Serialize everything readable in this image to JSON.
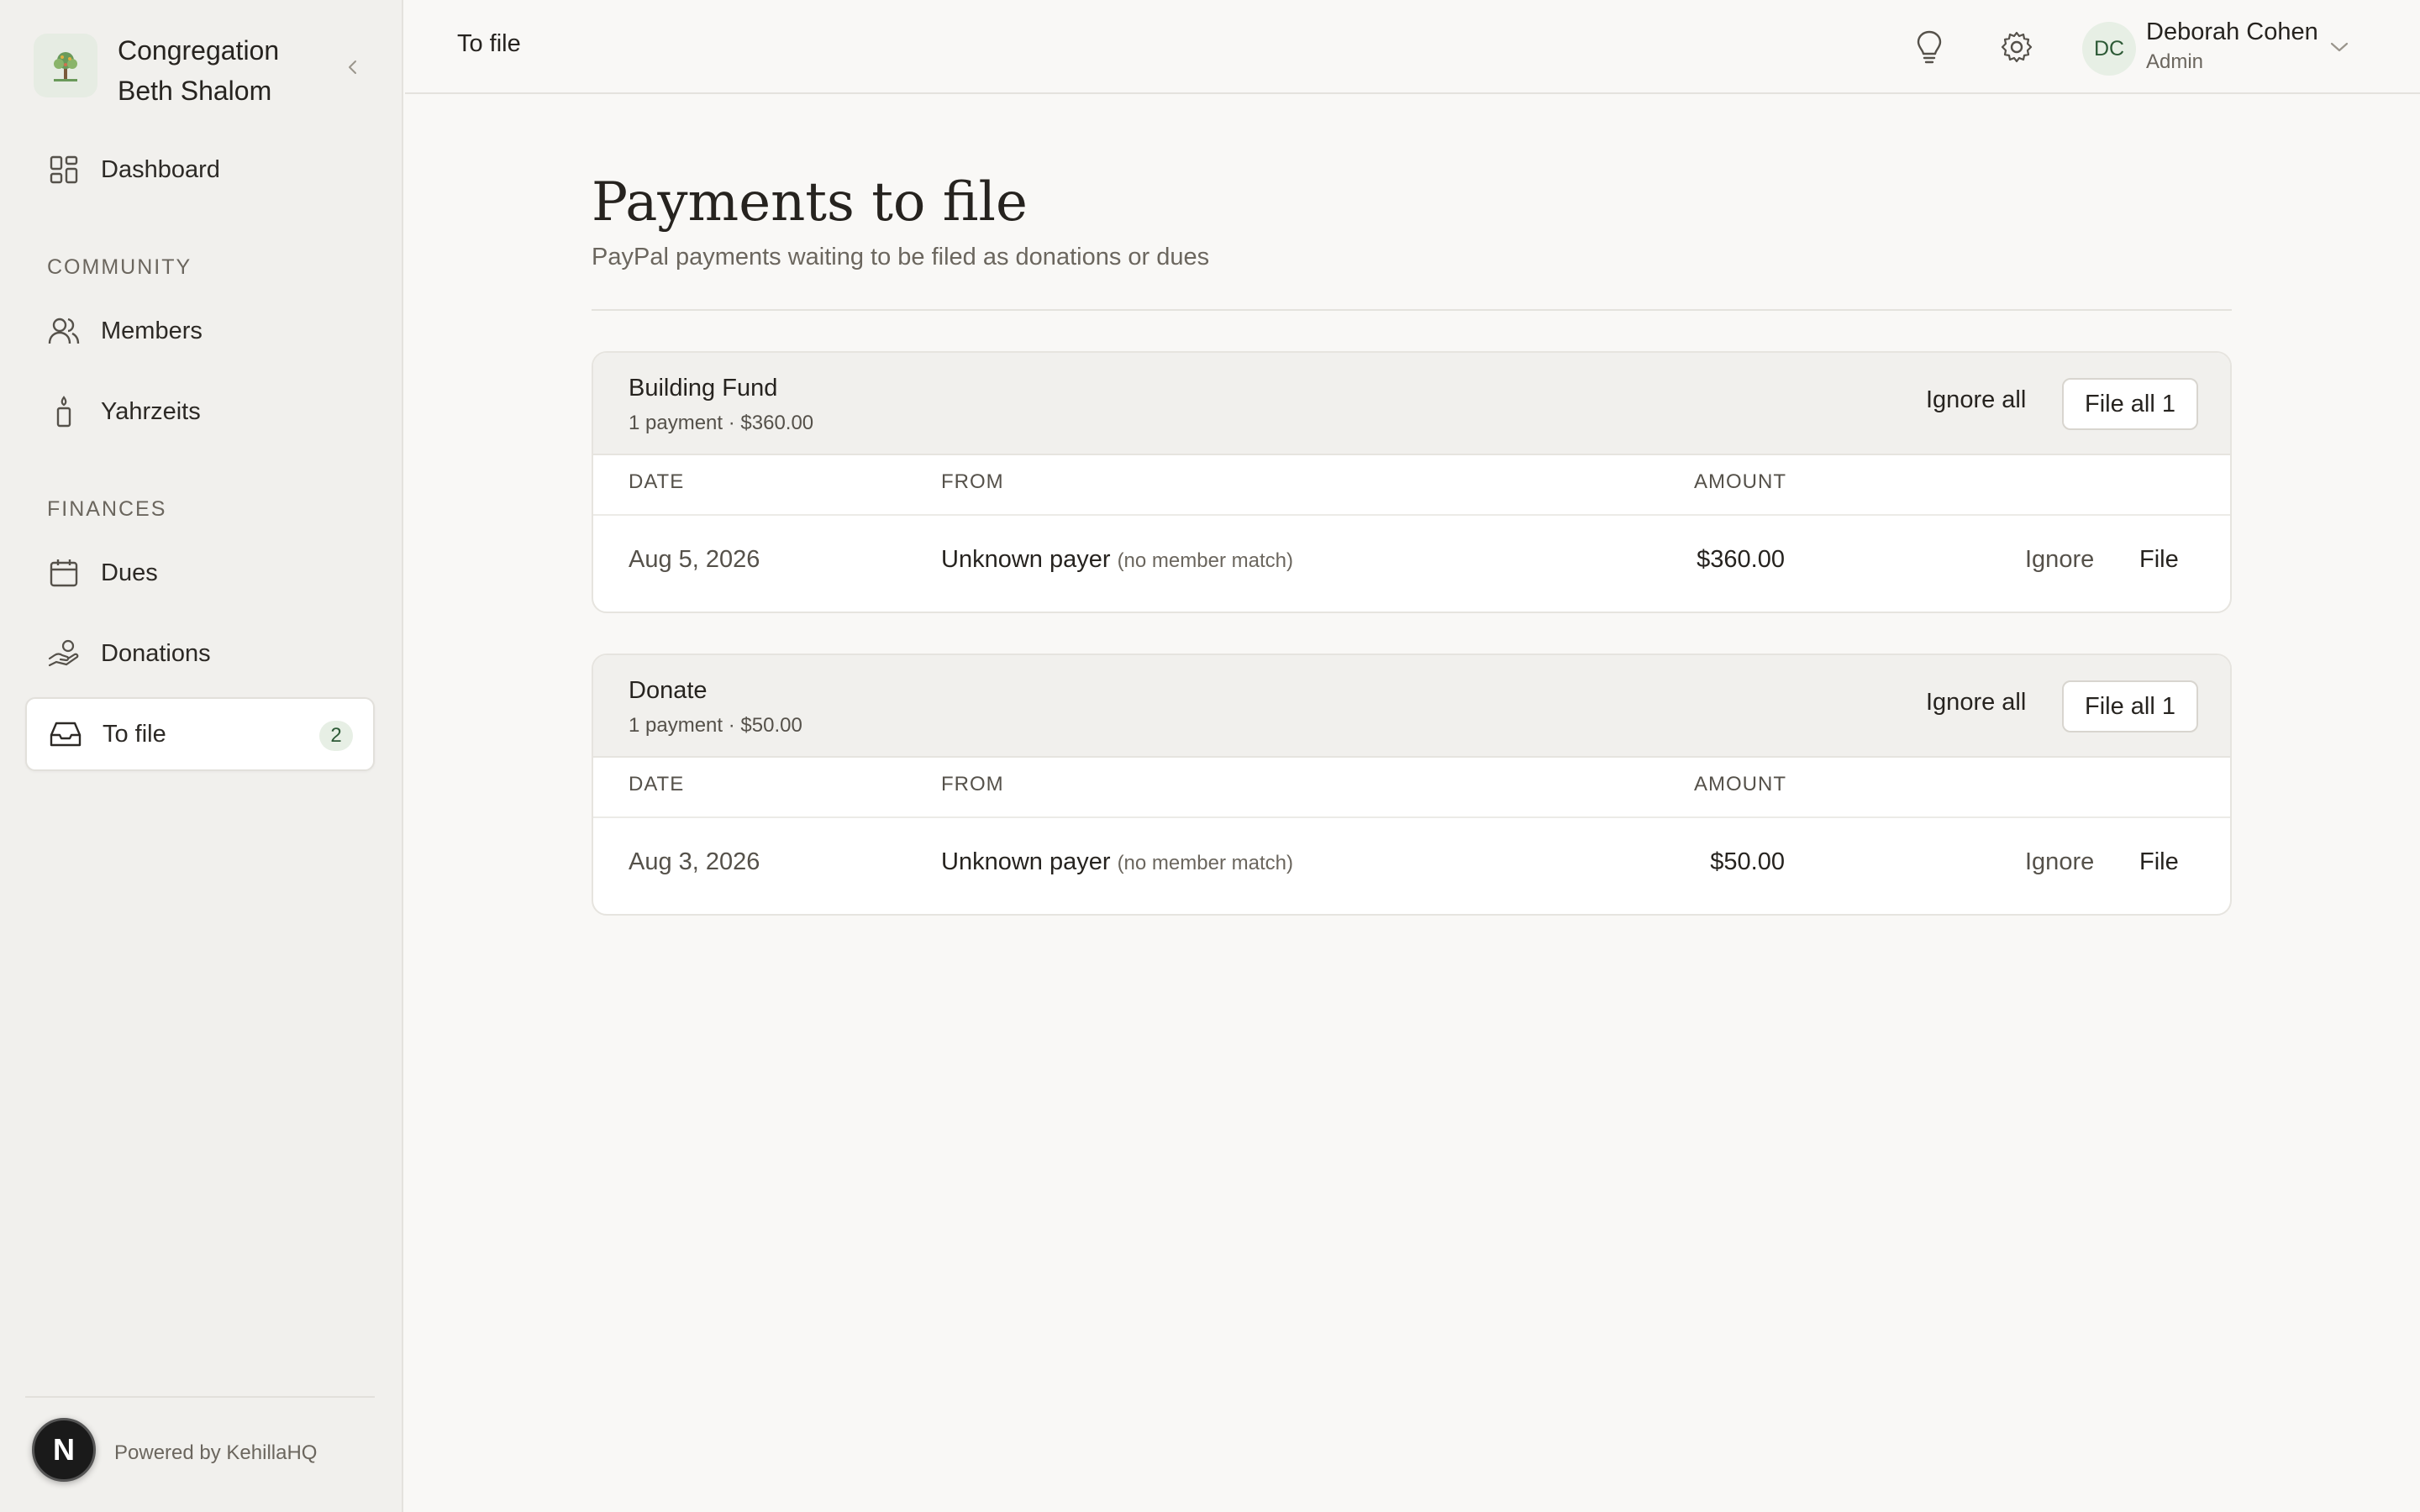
{
  "sidebar": {
    "org_name": "Congregation Beth Shalom",
    "nav": {
      "dashboard": "Dashboard",
      "community_label": "COMMUNITY",
      "members": "Members",
      "yahrzeits": "Yahrzeits",
      "finances_label": "FINANCES",
      "dues": "Dues",
      "donations": "Donations",
      "to_file": "To file",
      "to_file_count": "2"
    },
    "powered_by": "Powered by KehillaHQ",
    "n_badge": "N"
  },
  "header": {
    "breadcrumb": "To file",
    "user": {
      "initials": "DC",
      "name": "Deborah Cohen",
      "role": "Admin"
    }
  },
  "page": {
    "title": "Payments to file",
    "subtitle": "PayPal payments waiting to be filed as donations or dues"
  },
  "columns": {
    "date": "DATE",
    "from": "FROM",
    "amount": "AMOUNT"
  },
  "actions": {
    "ignore_all": "Ignore all",
    "file_all": "File all 1",
    "ignore": "Ignore",
    "file": "File"
  },
  "groups": [
    {
      "name": "Building Fund",
      "summary": "1 payment · $360.00",
      "rows": [
        {
          "date": "Aug 5, 2026",
          "from": "Unknown payer",
          "note": "(no member match)",
          "amount": "$360.00"
        }
      ]
    },
    {
      "name": "Donate",
      "summary": "1 payment · $50.00",
      "rows": [
        {
          "date": "Aug 3, 2026",
          "from": "Unknown payer",
          "note": "(no member match)",
          "amount": "$50.00"
        }
      ]
    }
  ],
  "colors": {
    "accent_green": "#2d5a36",
    "badge_bg": "#e7efe5",
    "sidebar_bg": "#f1f0ed",
    "page_bg": "#f9f8f6"
  }
}
